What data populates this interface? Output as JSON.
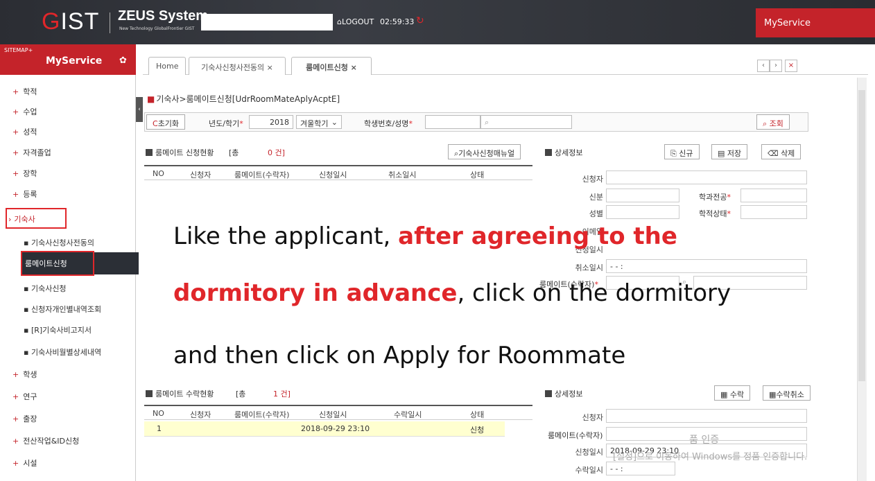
{
  "header": {
    "logo_g": "G",
    "logo_rest": "IST",
    "system_name": "ZEUS System",
    "system_tagline": "New Technology GlobalFrontier GIST",
    "logout_label": "LOGOUT",
    "session_timer": "02:59:33",
    "myservice_label": "MyService"
  },
  "sitemap": {
    "label": "SITEMAP+",
    "title": "MyService"
  },
  "sidebar": {
    "items": [
      {
        "label": "학적"
      },
      {
        "label": "수업"
      },
      {
        "label": "성적"
      },
      {
        "label": "자격졸업"
      },
      {
        "label": "장학"
      },
      {
        "label": "등록"
      },
      {
        "label": "기숙사"
      },
      {
        "label": "학생"
      },
      {
        "label": "연구"
      },
      {
        "label": "출장"
      },
      {
        "label": "전산작업&ID신청"
      },
      {
        "label": "시설"
      }
    ],
    "sub_items": [
      {
        "label": "기숙사신청사전동의"
      },
      {
        "label": "룸메이트신청"
      },
      {
        "label": "기숙사신청"
      },
      {
        "label": "신청자개인별내역조회"
      },
      {
        "label": "[R]기숙사비고지서"
      },
      {
        "label": "기숙사비월별상세내역"
      }
    ]
  },
  "tabs": [
    {
      "label": "Home"
    },
    {
      "label": "기숙사신청사전동의 ×"
    },
    {
      "label": "룸메이트신청 ×"
    }
  ],
  "tab_nav": {
    "prev": "‹",
    "next": "›",
    "close": "×"
  },
  "page": {
    "title": "기숙사>룸메이트신청[UdrRoomMateAplyAcptE]"
  },
  "search": {
    "reset_label": "초기화",
    "year_label": "년도/학기",
    "year_value": "2018",
    "term_value": "겨울학기",
    "student_label": "학생번호/성명",
    "search_label": "조회"
  },
  "applications": {
    "title": "룸메이트 신청현황",
    "total_prefix": "[총",
    "count": "0 건]",
    "manual_button": "기숙사신청매뉴얼",
    "columns": [
      "NO",
      "신청자",
      "룸메이트(수락자)",
      "신청일시",
      "취소일시",
      "상태"
    ]
  },
  "detail1": {
    "title": "상세정보",
    "new_label": "신규",
    "save_label": "저장",
    "delete_label": "삭제",
    "fields": {
      "applicant": "신청자",
      "division": "신분",
      "major": "학과전공",
      "gender": "성별",
      "status": "학적상태",
      "email": "이메일",
      "apply_date": "신청일시",
      "cancel_date": "취소일시",
      "cancel_value": "- -  :",
      "roommate": "룸메이트(수락자)"
    }
  },
  "acceptances": {
    "title": "룸메이트 수락현황",
    "total_prefix": "[총",
    "count": "1 건]",
    "columns": [
      "NO",
      "신청자",
      "룸메이트(수락자)",
      "신청일시",
      "수락일시",
      "상태"
    ],
    "rows": [
      {
        "no": "1",
        "applicant": "",
        "roommate": "",
        "apply_date": "2018-09-29 23:10",
        "accept_date": "",
        "status": "신청"
      }
    ]
  },
  "detail2": {
    "title": "상세정보",
    "accept_label": "수락",
    "cancel_accept_label": "수락취소",
    "fields": {
      "applicant": "신청자",
      "roommate": "룸메이트(수락자)",
      "apply_date": "신청일시",
      "apply_value": "2018-09-29 23:10",
      "accept_date": "수락일시",
      "accept_value": "- -  :"
    }
  },
  "overlay": {
    "line1_a": "Like the applicant, ",
    "line1_b": "after agreeing to the",
    "line2_a": "dormitory in advance",
    "line2_b": ", click on the dormitory",
    "line3": "and then click on Apply for Roommate"
  },
  "watermark": {
    "title": "품 인증",
    "text": "[설정]으로 이동하여 Windows를 정품 인증합니다."
  },
  "colors": {
    "brand_red": "#c4232a",
    "header_dark": "#2b2d33"
  }
}
